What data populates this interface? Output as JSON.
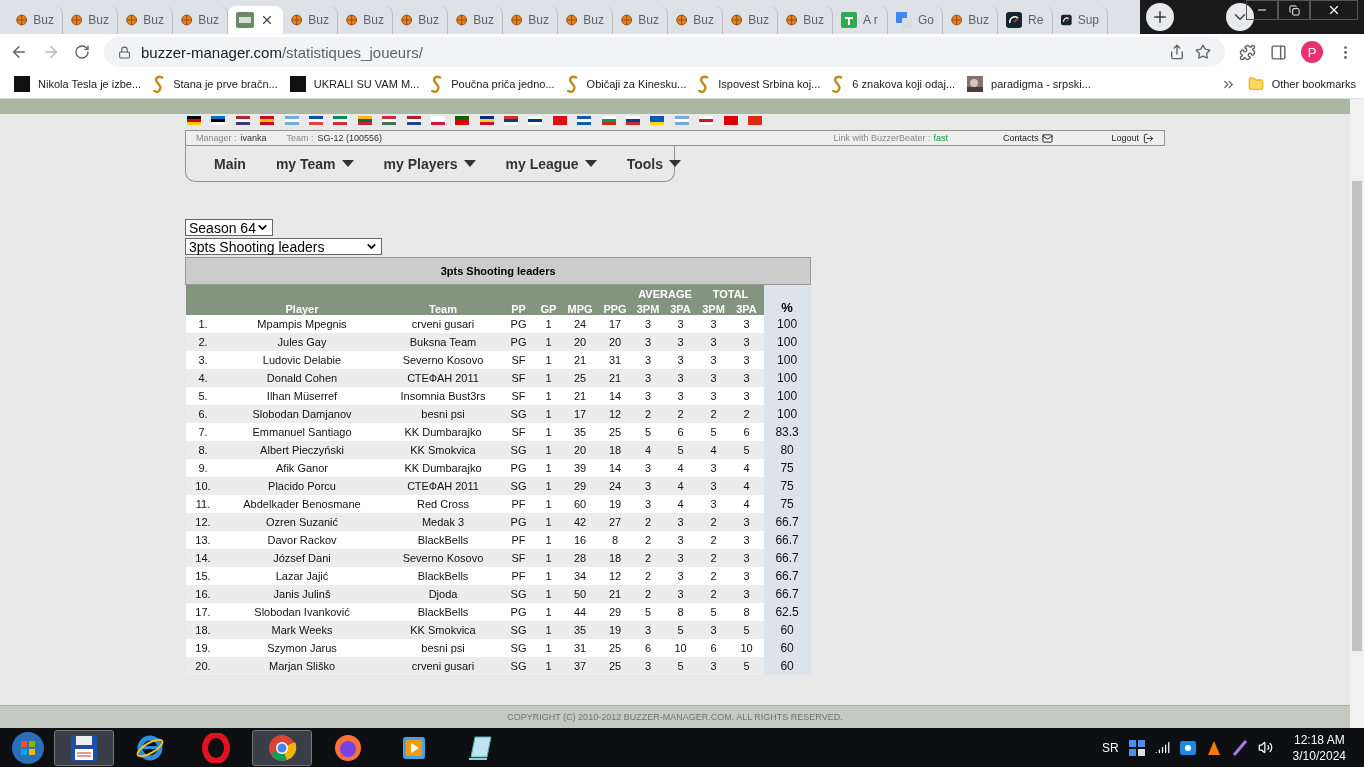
{
  "browser": {
    "tabs": [
      {
        "kind": "ball",
        "label": "Buz",
        "selected": false
      },
      {
        "kind": "ball",
        "label": "Buz",
        "selected": false
      },
      {
        "kind": "ball",
        "label": "Buz",
        "selected": false
      },
      {
        "kind": "ball",
        "label": "Buz",
        "selected": false
      },
      {
        "kind": "bm",
        "selected": true
      },
      {
        "kind": "ball",
        "label": "Buz",
        "selected": false
      },
      {
        "kind": "ball",
        "label": "Buz",
        "selected": false
      },
      {
        "kind": "ball",
        "label": "Buz",
        "selected": false
      },
      {
        "kind": "ball",
        "label": "Buz",
        "selected": false
      },
      {
        "kind": "ball",
        "label": "Buz",
        "selected": false
      },
      {
        "kind": "ball",
        "label": "Buz",
        "selected": false
      },
      {
        "kind": "ball",
        "label": "Buz",
        "selected": false
      },
      {
        "kind": "ball",
        "label": "Buz",
        "selected": false
      },
      {
        "kind": "ball",
        "label": "Buz",
        "selected": false
      },
      {
        "kind": "ball",
        "label": "Buz",
        "selected": false
      },
      {
        "kind": "sheet",
        "label": "A r",
        "selected": false
      },
      {
        "kind": "translate",
        "label": "Go",
        "selected": false
      },
      {
        "kind": "ball",
        "label": "Buz",
        "selected": false
      },
      {
        "kind": "gauge",
        "label": "Re",
        "selected": false
      },
      {
        "kind": "gauge",
        "label": "Sup",
        "selected": false
      }
    ],
    "url": {
      "host": "buzzer-manager.com",
      "path": "/statistiques_joueurs/"
    },
    "profile": "P",
    "bookmarks": [
      {
        "kind": "k",
        "label": "Nikola Tesla je izbe..."
      },
      {
        "kind": "s",
        "label": "Stana je prve bračn..."
      },
      {
        "kind": "k",
        "label": "UKRALI SU VAM M..."
      },
      {
        "kind": "s",
        "label": "Poučna priča jedno..."
      },
      {
        "kind": "s",
        "label": "Običaji za Kinesku..."
      },
      {
        "kind": "s",
        "label": "Ispovest Srbina koj..."
      },
      {
        "kind": "s",
        "label": "6 znakova koji odaj..."
      },
      {
        "label": "paradigma - srpski..."
      }
    ],
    "other_bookmarks": "Other bookmarks"
  },
  "header": {
    "manager_label": "Manager :",
    "manager": "ivanka",
    "team_label": "Team :",
    "team": "SG-12 (100556)",
    "link_label": "Link with BuzzerBeater :",
    "link_speed": "fast",
    "contacts": "Contacts",
    "logout": "Logout"
  },
  "nav": [
    {
      "label": "Main",
      "dropdown": false
    },
    {
      "label": "my Team",
      "dropdown": true
    },
    {
      "label": "my Players",
      "dropdown": true
    },
    {
      "label": "my League",
      "dropdown": true
    },
    {
      "label": "Tools",
      "dropdown": true
    }
  ],
  "season_select": "Season 64",
  "stat_select": "3pts Shooting leaders",
  "table": {
    "title": "3pts Shooting leaders",
    "groups": [
      "AVERAGE",
      "TOTAL"
    ],
    "columns": [
      "",
      "Player",
      "Team",
      "PP",
      "GP",
      "MPG",
      "PPG",
      "3PM",
      "3PA",
      "3PM",
      "3PA",
      "%"
    ],
    "rows": [
      [
        "1.",
        "Mpampis Mpegnis",
        "crveni gusari",
        "PG",
        "1",
        "24",
        "17",
        "3",
        "3",
        "3",
        "3",
        "100"
      ],
      [
        "2.",
        "Jules Gay",
        "Buksna Team",
        "PG",
        "1",
        "20",
        "20",
        "3",
        "3",
        "3",
        "3",
        "100"
      ],
      [
        "3.",
        "Ludovic Delabie",
        "Severno Kosovo",
        "SF",
        "1",
        "21",
        "31",
        "3",
        "3",
        "3",
        "3",
        "100"
      ],
      [
        "4.",
        "Donald Cohen",
        "СТЕФАН 2011",
        "SF",
        "1",
        "25",
        "21",
        "3",
        "3",
        "3",
        "3",
        "100"
      ],
      [
        "5.",
        "Ilhan Müserref",
        "Insomnia Bust3rs",
        "SF",
        "1",
        "21",
        "14",
        "3",
        "3",
        "3",
        "3",
        "100"
      ],
      [
        "6.",
        "Slobodan Damjanov",
        "besni psi",
        "SG",
        "1",
        "17",
        "12",
        "2",
        "2",
        "2",
        "2",
        "100"
      ],
      [
        "7.",
        "Emmanuel Santiago",
        "KK Dumbarajko",
        "SF",
        "1",
        "35",
        "25",
        "5",
        "6",
        "5",
        "6",
        "83.3"
      ],
      [
        "8.",
        "Albert Pieczyński",
        "KK Smokvica",
        "SG",
        "1",
        "20",
        "18",
        "4",
        "5",
        "4",
        "5",
        "80"
      ],
      [
        "9.",
        "Afik Ganor",
        "KK Dumbarajko",
        "PG",
        "1",
        "39",
        "14",
        "3",
        "4",
        "3",
        "4",
        "75"
      ],
      [
        "10.",
        "Placido Porcu",
        "СТЕФАН 2011",
        "SG",
        "1",
        "29",
        "24",
        "3",
        "4",
        "3",
        "4",
        "75"
      ],
      [
        "11.",
        "Abdelkader Benosmane",
        "Red Cross",
        "PF",
        "1",
        "60",
        "19",
        "3",
        "4",
        "3",
        "4",
        "75"
      ],
      [
        "12.",
        "Ozren Suzanić",
        "Medak 3",
        "PG",
        "1",
        "42",
        "27",
        "2",
        "3",
        "2",
        "3",
        "66.7"
      ],
      [
        "13.",
        "Davor Rackov",
        "BlackBells",
        "PF",
        "1",
        "16",
        "8",
        "2",
        "3",
        "2",
        "3",
        "66.7"
      ],
      [
        "14.",
        "József Dani",
        "Severno Kosovo",
        "SF",
        "1",
        "28",
        "18",
        "2",
        "3",
        "2",
        "3",
        "66.7"
      ],
      [
        "15.",
        "Lazar Jajić",
        "BlackBells",
        "PF",
        "1",
        "34",
        "12",
        "2",
        "3",
        "2",
        "3",
        "66.7"
      ],
      [
        "16.",
        "Janis Julinš",
        "Djoda",
        "SG",
        "1",
        "50",
        "21",
        "2",
        "3",
        "2",
        "3",
        "66.7"
      ],
      [
        "17.",
        "Slobodan Ivanković",
        "BlackBells",
        "PG",
        "1",
        "44",
        "29",
        "5",
        "8",
        "5",
        "8",
        "62.5"
      ],
      [
        "18.",
        "Mark Weeks",
        "KK Smokvica",
        "SG",
        "1",
        "35",
        "19",
        "3",
        "5",
        "3",
        "5",
        "60"
      ],
      [
        "19.",
        "Szymon Jarus",
        "besni psi",
        "SG",
        "1",
        "31",
        "25",
        "6",
        "10",
        "6",
        "10",
        "60"
      ],
      [
        "20.",
        "Marjan Sliško",
        "crveni gusari",
        "SG",
        "1",
        "37",
        "25",
        "3",
        "5",
        "3",
        "5",
        "60"
      ]
    ]
  },
  "footer": "COPYRIGHT (C) 2010-2012 BUZZER-MANAGER.COM. ALL RIGHTS RESERVED.",
  "taskbar": {
    "apps": [
      {
        "kind": "floppy",
        "selected": true
      },
      {
        "kind": "ie",
        "selected": false
      },
      {
        "kind": "opera",
        "selected": false
      },
      {
        "kind": "chrome",
        "selected": true
      },
      {
        "kind": "firefox",
        "selected": false
      },
      {
        "kind": "media",
        "selected": false
      },
      {
        "kind": "notes",
        "selected": false
      }
    ],
    "language": "SR",
    "time": "12:18 AM",
    "date": "3/10/2024"
  }
}
